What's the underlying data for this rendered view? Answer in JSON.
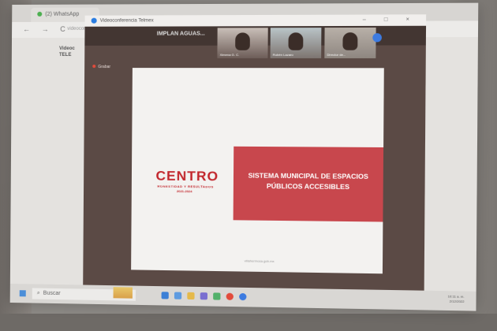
{
  "browser": {
    "tab_title": "(2) WhatsApp",
    "nav": "← → C",
    "url": "videoconferencia telmex"
  },
  "side_page": {
    "line1": "Videoc",
    "line2": "TELE"
  },
  "conference": {
    "window_title": "Videoconferencia Telmex",
    "window_controls": "– □ ×",
    "meeting_name": "IMPLAN AGUAS...",
    "participants": [
      {
        "name": "Ximena G. C."
      },
      {
        "name": "Rubén Lazaro"
      },
      {
        "name": "Director de..."
      }
    ],
    "left_label": "Grabar"
  },
  "slide": {
    "brand": "CENTRO",
    "brand_sub": "HONESTIDAD Y RESULTADOS",
    "brand_years": "2021-2024",
    "title": "SISTEMA MUNICIPAL DE ESPACIOS PÚBLICOS ACCESIBLES",
    "footer_url": "villahermosa.gob.mx"
  },
  "taskbar": {
    "search_label": "Buscar",
    "time": "10:11 a. m.",
    "date": "2/12/2022"
  },
  "colors": {
    "brand_red": "#c2272d",
    "title_box": "#c8474d",
    "conference_bg": "#5b4a45"
  }
}
